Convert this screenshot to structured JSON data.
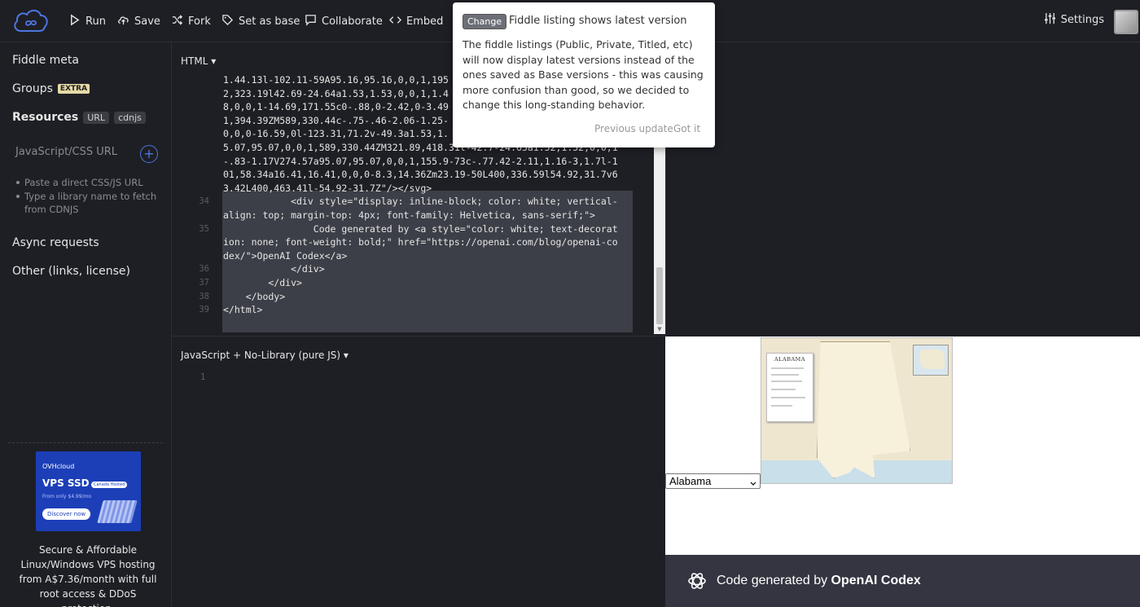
{
  "toolbar": {
    "run": "Run",
    "save": "Save",
    "fork": "Fork",
    "set_base": "Set as base",
    "collaborate": "Collaborate",
    "embed": "Embed",
    "settings": "Settings"
  },
  "sidebar": {
    "fiddle_meta": "Fiddle meta",
    "groups": "Groups",
    "groups_badge": "EXTRA",
    "resources": "Resources",
    "resources_badge_url": "URL",
    "resources_badge_cdnjs": "cdnjs",
    "url_placeholder": "JavaScript/CSS URL",
    "hints": [
      "Paste a direct CSS/JS URL",
      "Type a library name to fetch from CDNJS"
    ],
    "async": "Async requests",
    "other": "Other (links, license)"
  },
  "ad": {
    "brand": "OVHcloud",
    "headline": "VPS SSD",
    "tag": "Canada Hosted",
    "sub": "From only $4.99/mo",
    "cta": "Discover now",
    "text": "Secure & Affordable Linux/Windows VPS hosting from A$7.36/month with full root access & DDoS protection."
  },
  "html_panel": {
    "label": "HTML",
    "lines": [
      {
        "num": "",
        "text": "1.44.13l-102.11-59A95.16,95.16,0,0,1,195"
      },
      {
        "num": "",
        "text": "2,323.19l42.69-24.64a1.53,1.53,0,0,1,1.4"
      },
      {
        "num": "",
        "text": "8,0,0,1-14.69,171.55c0-.88,0-2.42,0-3.49"
      },
      {
        "num": "",
        "text": "1,394.39ZM589,330.44c-.75-.46-2.06-1.25-"
      },
      {
        "num": "",
        "text": "0,0,0-16.59,0l-123.31,71.2v-49.3a1.53,1."
      },
      {
        "num": "",
        "text": "5.07,95.07,0,0,1,589,330.44ZM321.89,418.31l-42.7-24.65a1.52,1.52,0,0,1"
      },
      {
        "num": "",
        "text": "-.83-1.17V274.57a95.07,95.07,0,0,1,155.9-73c-.77.42-2.11,1.16-3,1.7l-1"
      },
      {
        "num": "",
        "text": "01,58.34a16.41,16.41,0,0,0-8.3,14.36Zm23.19-50L400,336.59l54.92,31.7v6"
      },
      {
        "num": "",
        "text": "3.42L400,463.41l-54.92-31.7Z\"/></svg>"
      },
      {
        "num": "34",
        "text": "            <div style=\"display: inline-block; color: white; vertical-"
      },
      {
        "num": "",
        "text": "align: top; margin-top: 4px; font-family: Helvetica, sans-serif;\">"
      },
      {
        "num": "35",
        "text": "                Code generated by <a style=\"color: white; text-decorat"
      },
      {
        "num": "",
        "text": "ion: none; font-weight: bold;\" href=\"https://openai.com/blog/openai-co"
      },
      {
        "num": "",
        "text": "dex/\">OpenAI Codex</a>"
      },
      {
        "num": "36",
        "text": "            </div>"
      },
      {
        "num": "37",
        "text": "        </div>"
      },
      {
        "num": "38",
        "text": "    </body>"
      },
      {
        "num": "39",
        "text": "</html>"
      }
    ]
  },
  "js_panel": {
    "label": "JavaScript + No-Library (pure JS)",
    "first_line_num": "1"
  },
  "result": {
    "map_title": "ALABAMA",
    "select_value": "Alabama",
    "footer_prefix": "Code generated by ",
    "footer_brand": "OpenAI Codex"
  },
  "popup": {
    "badge": "Change",
    "title": "Fiddle listing shows latest version",
    "body": "The fiddle listings (Public, Private, Titled, etc) will now display latest versions instead of the ones saved as Base versions - this was causing more confusion than good, so we decided to change this long-standing behavior.",
    "previous": "Previous update",
    "got_it": "Got it"
  },
  "colors": {
    "background": "#1e1f25",
    "accent": "#4d76e0",
    "extra_badge": "#e5d9a6",
    "ad_blue": "#1c3fb8",
    "result_footer": "#343541"
  }
}
